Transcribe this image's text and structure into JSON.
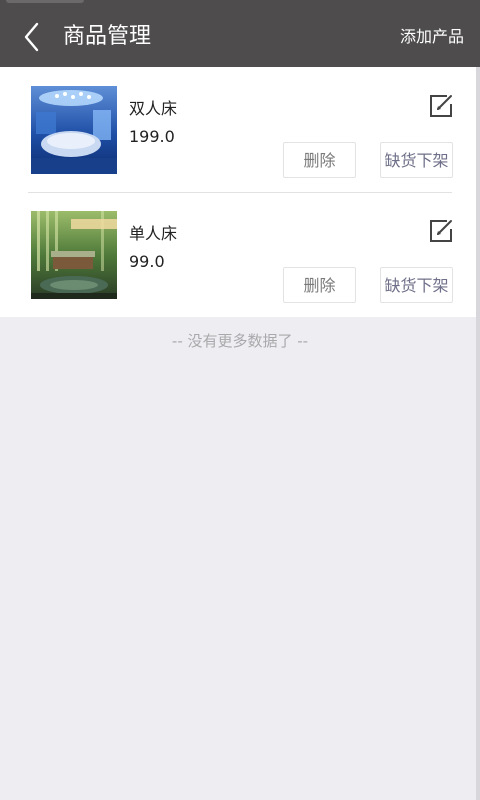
{
  "header": {
    "title": "商品管理",
    "add_label": "添加产品",
    "back_icon": "chevron-left-icon"
  },
  "products": [
    {
      "name": "双人床",
      "price": "199.0",
      "delete_label": "删除",
      "offshelf_label": "缺货下架",
      "image": "blue-themed double bed room photo"
    },
    {
      "name": "单人床",
      "price": "99.0",
      "delete_label": "删除",
      "offshelf_label": "缺货下架",
      "image": "green bamboo themed single bed room photo"
    }
  ],
  "footer": {
    "no_more_text": "-- 没有更多数据了 --"
  },
  "colors": {
    "header_bg": "#4e4c4d",
    "page_bg": "#eeedf2",
    "offshelf_text": "#6f7089",
    "muted_text": "#a9a9ab"
  }
}
